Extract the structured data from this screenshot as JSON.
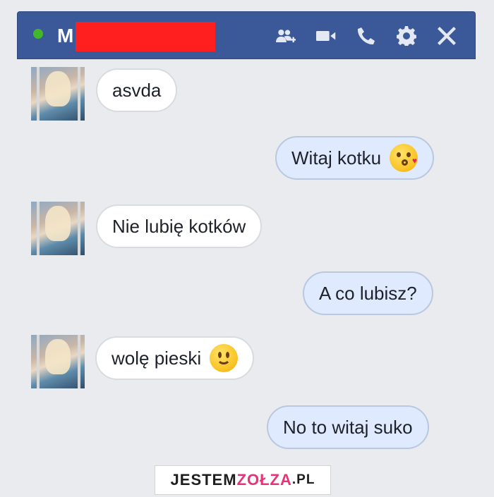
{
  "chat": {
    "contact_initial": "M",
    "status": "online",
    "accent_color": "#3b5998",
    "icons": [
      "add-friend-icon",
      "video-call-icon",
      "phone-icon",
      "settings-icon",
      "close-icon"
    ]
  },
  "messages": [
    {
      "direction": "incoming",
      "text": "asvda"
    },
    {
      "direction": "outgoing",
      "text": "Witaj kotku",
      "emoji": "kissing-face-emoji"
    },
    {
      "direction": "incoming",
      "text": "Nie lubię kotków"
    },
    {
      "direction": "outgoing",
      "text": "A co lubisz?"
    },
    {
      "direction": "incoming",
      "text": "wolę pieski",
      "emoji": "smiling-face-emoji"
    },
    {
      "direction": "outgoing",
      "text": "No to witaj suko"
    }
  ],
  "watermark": {
    "part1": "JESTEM",
    "part2": "ZOŁZA",
    "part3": ".PL"
  }
}
